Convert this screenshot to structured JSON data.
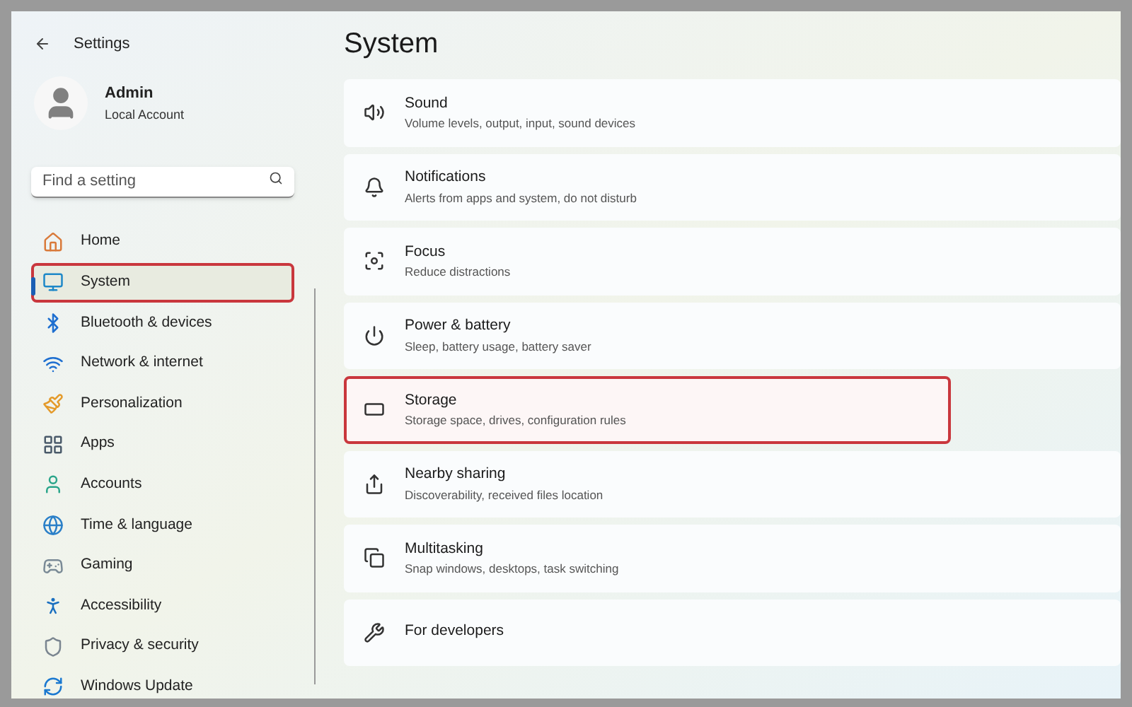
{
  "window": {
    "title": "Settings"
  },
  "account": {
    "name": "Admin",
    "type": "Local Account"
  },
  "search": {
    "placeholder": "Find a setting"
  },
  "sidebar": {
    "items": [
      {
        "label": "Home",
        "selected": false,
        "highlighted": false
      },
      {
        "label": "System",
        "selected": true,
        "highlighted": true
      },
      {
        "label": "Bluetooth & devices",
        "selected": false,
        "highlighted": false
      },
      {
        "label": "Network & internet",
        "selected": false,
        "highlighted": false
      },
      {
        "label": "Personalization",
        "selected": false,
        "highlighted": false
      },
      {
        "label": "Apps",
        "selected": false,
        "highlighted": false
      },
      {
        "label": "Accounts",
        "selected": false,
        "highlighted": false
      },
      {
        "label": "Time & language",
        "selected": false,
        "highlighted": false
      },
      {
        "label": "Gaming",
        "selected": false,
        "highlighted": false
      },
      {
        "label": "Accessibility",
        "selected": false,
        "highlighted": false
      },
      {
        "label": "Privacy & security",
        "selected": false,
        "highlighted": false
      },
      {
        "label": "Windows Update",
        "selected": false,
        "highlighted": false
      }
    ]
  },
  "page": {
    "title": "System",
    "cards": [
      {
        "title": "Sound",
        "description": "Volume levels, output, input, sound devices",
        "highlighted": false
      },
      {
        "title": "Notifications",
        "description": "Alerts from apps and system, do not disturb",
        "highlighted": false
      },
      {
        "title": "Focus",
        "description": "Reduce distractions",
        "highlighted": false
      },
      {
        "title": "Power & battery",
        "description": "Sleep, battery usage, battery saver",
        "highlighted": false
      },
      {
        "title": "Storage",
        "description": "Storage space, drives, configuration rules",
        "highlighted": true
      },
      {
        "title": "Nearby sharing",
        "description": "Discoverability, received files location",
        "highlighted": false
      },
      {
        "title": "Multitasking",
        "description": "Snap windows, desktops, task switching",
        "highlighted": false
      },
      {
        "title": "For developers",
        "highlighted": false
      }
    ]
  }
}
